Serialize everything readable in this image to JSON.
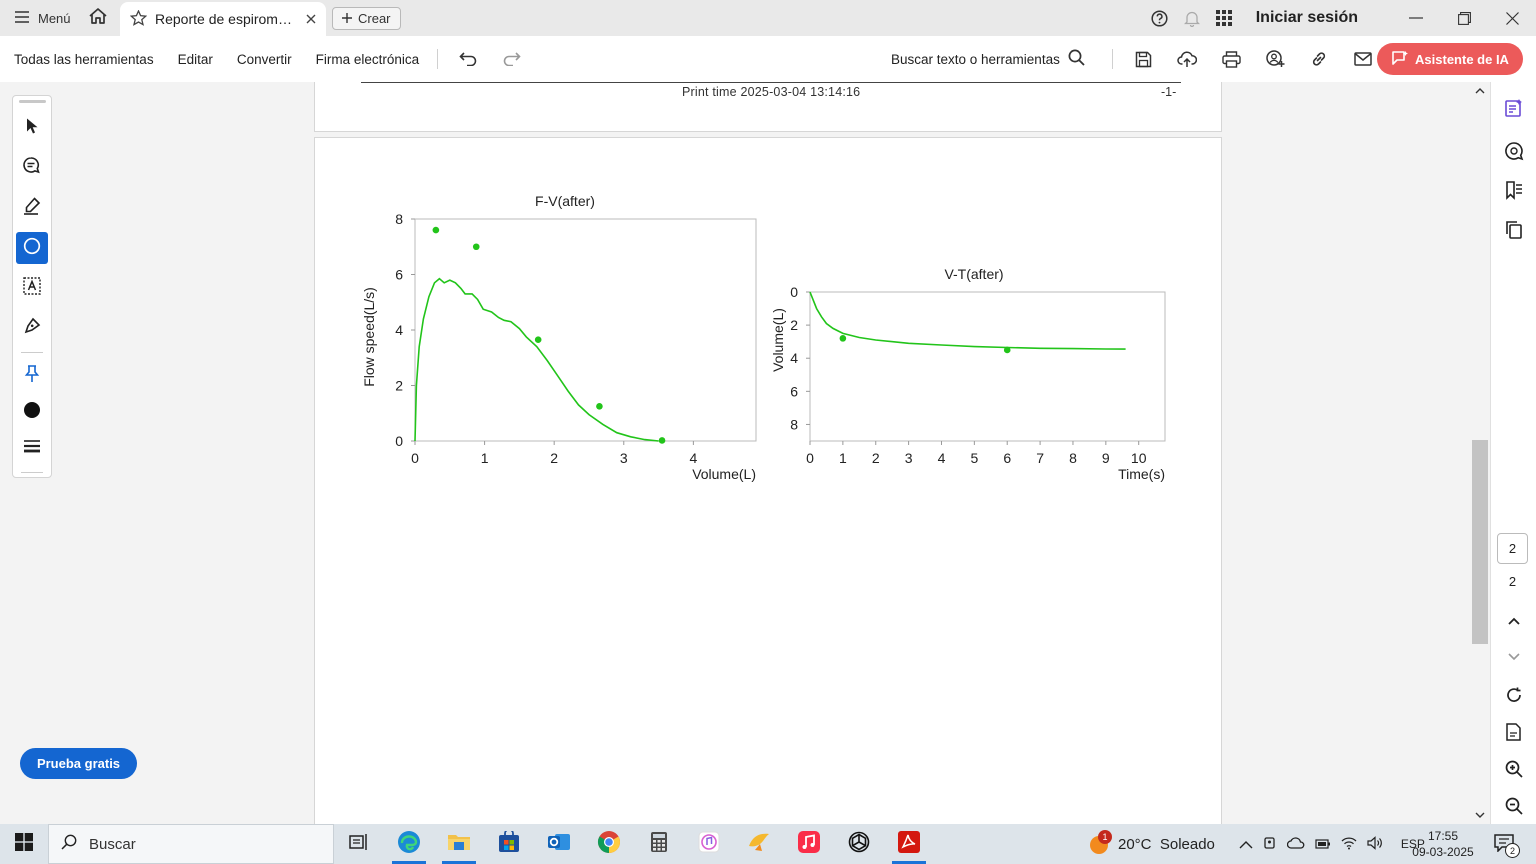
{
  "titlebar": {
    "menu_label": "Menú",
    "tab_title": "Reporte de espirometr...",
    "create_label": "Crear",
    "signin_label": "Iniciar sesión"
  },
  "toolbar": {
    "all_tools": "Todas las herramientas",
    "edit": "Editar",
    "convert": "Convertir",
    "esign": "Firma electrónica",
    "search_tools": "Buscar texto o herramientas",
    "ai_assistant": "Asistente de IA"
  },
  "document": {
    "print_time": "Print time 2025-03-04 13:14:16",
    "page_marker": "-1-"
  },
  "chart_data": [
    {
      "type": "line",
      "title": "F-V(after)",
      "xlabel": "Volume(L)",
      "ylabel": "Flow speed(L/s)",
      "xlim": [
        0,
        4.9
      ],
      "ylim": [
        0,
        8
      ],
      "xticks": [
        "0",
        "1",
        "2",
        "3",
        "4"
      ],
      "yticks": [
        "0",
        "2",
        "4",
        "6",
        "8"
      ],
      "series": [
        {
          "curve": [
            [
              0,
              0
            ],
            [
              0.02,
              2.0
            ],
            [
              0.06,
              3.4
            ],
            [
              0.12,
              4.4
            ],
            [
              0.2,
              5.2
            ],
            [
              0.28,
              5.7
            ],
            [
              0.35,
              5.85
            ],
            [
              0.42,
              5.7
            ],
            [
              0.5,
              5.8
            ],
            [
              0.58,
              5.7
            ],
            [
              0.66,
              5.5
            ],
            [
              0.72,
              5.3
            ],
            [
              0.82,
              5.3
            ],
            [
              0.9,
              5.1
            ],
            [
              0.98,
              4.75
            ],
            [
              1.1,
              4.65
            ],
            [
              1.2,
              4.45
            ],
            [
              1.28,
              4.35
            ],
            [
              1.38,
              4.3
            ],
            [
              1.5,
              4.05
            ],
            [
              1.6,
              3.75
            ],
            [
              1.75,
              3.4
            ],
            [
              1.9,
              2.9
            ],
            [
              2.05,
              2.35
            ],
            [
              2.2,
              1.8
            ],
            [
              2.35,
              1.3
            ],
            [
              2.5,
              0.95
            ],
            [
              2.7,
              0.6
            ],
            [
              2.9,
              0.3
            ],
            [
              3.1,
              0.15
            ],
            [
              3.3,
              0.05
            ],
            [
              3.5,
              0.0
            ]
          ],
          "points": [
            [
              0.3,
              7.6
            ],
            [
              0.88,
              7.0
            ],
            [
              1.77,
              3.65
            ],
            [
              2.65,
              1.25
            ],
            [
              3.55,
              0.02
            ]
          ]
        }
      ],
      "color": "#22c41a"
    },
    {
      "type": "line",
      "title": "V-T(after)",
      "xlabel": "Time(s)",
      "ylabel": "Volume(L)",
      "xlim": [
        0,
        10.8
      ],
      "ylim": [
        0,
        9
      ],
      "y_inverted": true,
      "xticks": [
        "0",
        "1",
        "2",
        "3",
        "4",
        "5",
        "6",
        "7",
        "8",
        "9",
        "10"
      ],
      "yticks": [
        "0",
        "2",
        "4",
        "6",
        "8"
      ],
      "series": [
        {
          "curve": [
            [
              0,
              0
            ],
            [
              0.1,
              0.5
            ],
            [
              0.2,
              1.0
            ],
            [
              0.35,
              1.5
            ],
            [
              0.5,
              1.9
            ],
            [
              0.7,
              2.2
            ],
            [
              1.0,
              2.5
            ],
            [
              1.5,
              2.75
            ],
            [
              2,
              2.9
            ],
            [
              3,
              3.1
            ],
            [
              4,
              3.2
            ],
            [
              5,
              3.3
            ],
            [
              6,
              3.35
            ],
            [
              7,
              3.4
            ],
            [
              8,
              3.42
            ],
            [
              9,
              3.44
            ],
            [
              9.6,
              3.45
            ]
          ],
          "points": [
            [
              1.0,
              2.8
            ],
            [
              6.0,
              3.5
            ]
          ]
        }
      ],
      "color": "#22c41a"
    }
  ],
  "rail": {
    "current_page": "2",
    "total_pages": "2"
  },
  "trial_button": "Prueba gratis",
  "taskbar": {
    "search_label": "Buscar",
    "weather": "20°C  Soleado",
    "weather_badge": "1",
    "language": "ESP",
    "time": "17:55",
    "date": "09-03-2025",
    "notifications": "2"
  }
}
